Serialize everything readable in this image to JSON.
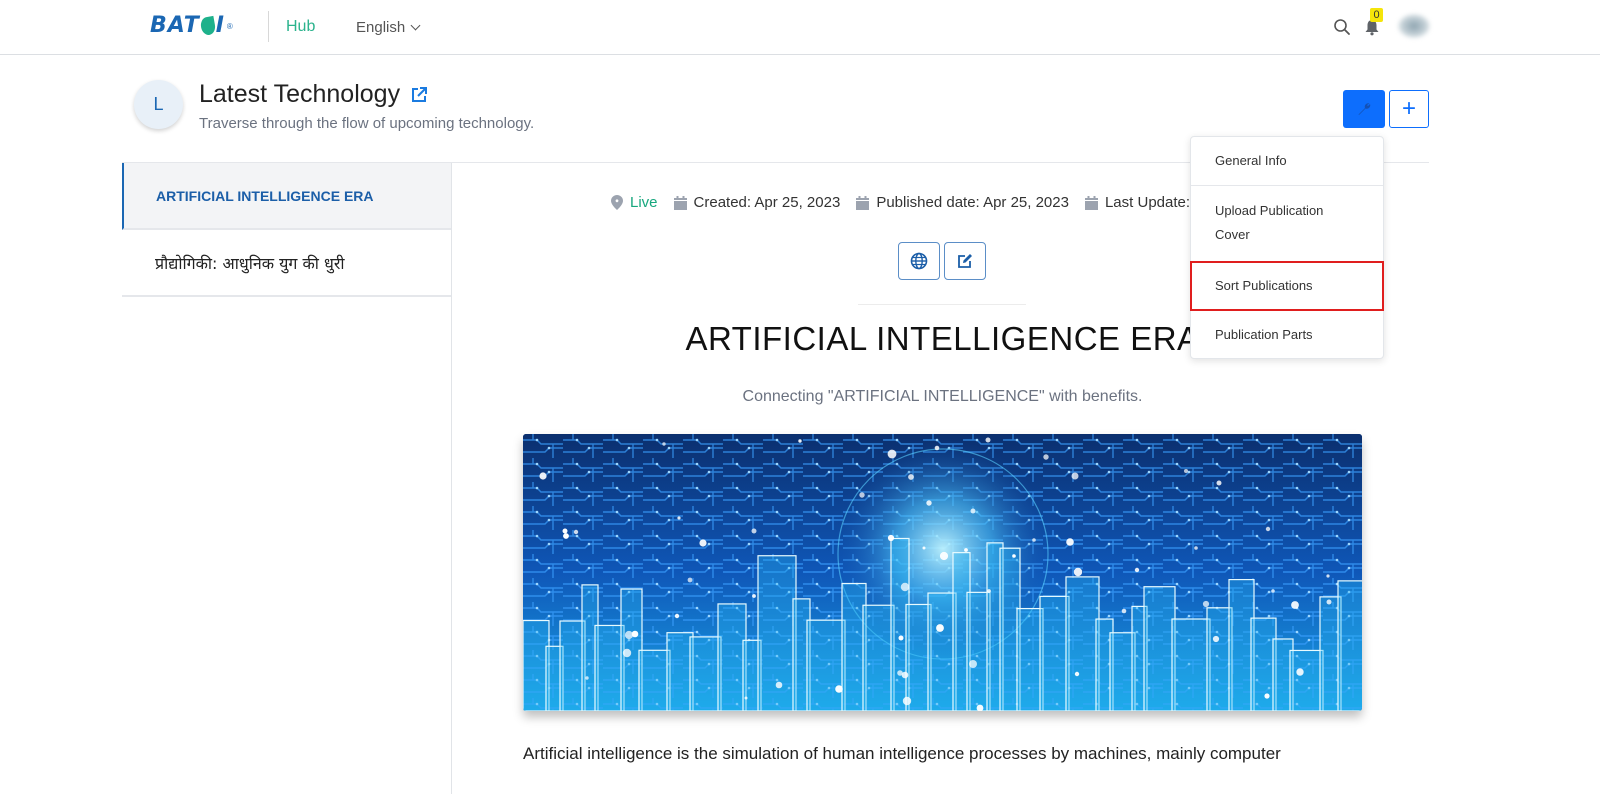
{
  "header": {
    "logo_text": "BAT",
    "logo_text_end": "I",
    "logo_reg": "®",
    "hub_label": "Hub",
    "language": "English",
    "notification_count": "0",
    "icons": {
      "search": "search-icon",
      "bell": "bell-icon",
      "avatar": "user-avatar"
    }
  },
  "publication": {
    "avatar_letter": "L",
    "title": "Latest Technology",
    "subtitle": "Traverse through the flow of upcoming technology.",
    "tool_button_icon": "wrench-icon",
    "add_button_label": "+"
  },
  "dropdown": {
    "items": [
      {
        "label": "General Info"
      },
      {
        "label": "Upload Publication"
      },
      {
        "label": "Cover"
      },
      {
        "label": "Sort Publications",
        "highlighted": true
      },
      {
        "label": "Publication Parts"
      }
    ]
  },
  "sidebar": {
    "items": [
      {
        "label": "ARTIFICIAL INTELLIGENCE ERA",
        "active": true
      },
      {
        "label": "प्रौद्योगिकी: आधुनिक युग की धुरी",
        "active": false
      }
    ]
  },
  "article": {
    "meta": {
      "status": "Live",
      "created": "Created: Apr 25, 2023",
      "published": "Published date: Apr 25, 2023",
      "last_update": "Last Update: A"
    },
    "actions": {
      "globe": "globe-icon",
      "edit": "edit-icon"
    },
    "title": "ARTIFICIAL INTELLIGENCE ERA",
    "subtitle": "Connecting \"ARTIFICIAL INTELLIGENCE\" with benefits.",
    "image_alt": "Blue circuit board city skyline with glowing sphere",
    "body_first_line": "Artificial intelligence is the simulation of human intelligence processes by machines, mainly computer"
  },
  "colors": {
    "brand_blue": "#1b67b3",
    "brand_green": "#2bb38d",
    "primary_button": "#0d6efd",
    "live_status": "#17a77e",
    "highlight_outline": "#e01e1e",
    "badge": "#f5e50a"
  }
}
